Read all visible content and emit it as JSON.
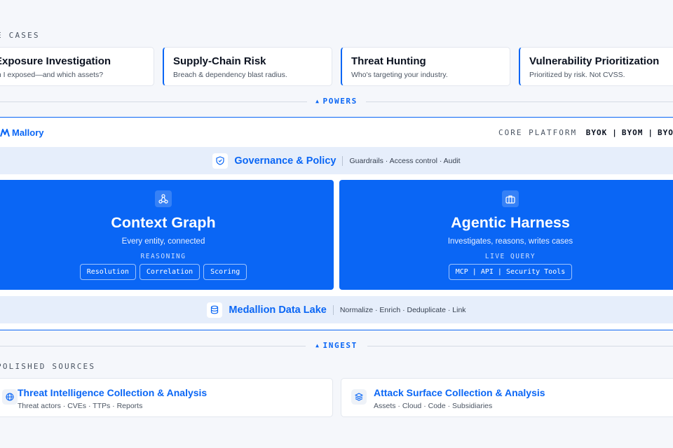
{
  "use_cases": {
    "label": "E CASES",
    "cards": [
      {
        "title": "Exposure Investigation",
        "subtitle": "m I exposed—and which assets?"
      },
      {
        "title": "Supply-Chain Risk",
        "subtitle": "Breach & dependency blast radius."
      },
      {
        "title": "Threat Hunting",
        "subtitle": "Who's targeting your industry."
      },
      {
        "title": "Vulnerability Prioritization",
        "subtitle": "Prioritized by risk. Not CVSS."
      }
    ]
  },
  "powers": {
    "label": "POWERS"
  },
  "platform": {
    "brand": "Mallory",
    "core_label": "CORE PLATFORM",
    "byo": [
      "BYOK",
      "BYOM",
      "BYO"
    ],
    "governance": {
      "title": "Governance & Policy",
      "desc": "Guardrails · Access control · Audit"
    },
    "context_graph": {
      "title": "Context Graph",
      "subtitle": "Every entity, connected",
      "kicker": "REASONING",
      "pills": [
        "Resolution",
        "Correlation",
        "Scoring"
      ]
    },
    "agentic_harness": {
      "title": "Agentic Harness",
      "subtitle": "Investigates, reasons, writes cases",
      "kicker": "LIVE QUERY",
      "pills": [
        "MCP | API | Security Tools"
      ]
    },
    "data_lake": {
      "title": "Medallion Data Lake",
      "desc": "Normalize · Enrich · Deduplicate · Link"
    }
  },
  "ingest": {
    "label": "INGEST"
  },
  "sources": {
    "label": "POLISHED SOURCES",
    "cards": [
      {
        "title": "Threat Intelligence Collection & Analysis",
        "subtitle": "Threat actors · CVEs · TTPs · Reports"
      },
      {
        "title": "Attack Surface Collection & Analysis",
        "subtitle": "Assets · Cloud · Code · Subsidiaries"
      }
    ]
  },
  "colors": {
    "accent": "#0a66f5",
    "band": "#e6eefb",
    "background": "#f5f7fb"
  },
  "icons": [
    "shield-icon",
    "graph-nodes-icon",
    "briefcase-icon",
    "database-icon",
    "globe-icon",
    "layers-icon",
    "mallory-logo-icon"
  ]
}
